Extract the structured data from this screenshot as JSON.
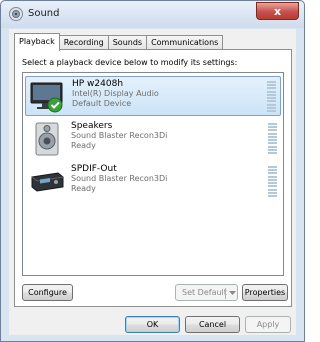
{
  "window": {
    "title": "Sound",
    "close_glyph": "x"
  },
  "tabs": [
    {
      "label": "Playback"
    },
    {
      "label": "Recording"
    },
    {
      "label": "Sounds"
    },
    {
      "label": "Communications"
    }
  ],
  "active_tab": "Playback",
  "instruction": "Select a playback device below to modify its settings:",
  "devices": [
    {
      "name": "HP w2408h",
      "description": "Intel(R) Display Audio",
      "status": "Default Device",
      "icon": "monitor-icon",
      "selected": true,
      "default": true
    },
    {
      "name": "Speakers",
      "description": "Sound Blaster Recon3Di",
      "status": "Ready",
      "icon": "speaker-icon",
      "selected": false,
      "default": false
    },
    {
      "name": "SPDIF-Out",
      "description": "Sound Blaster Recon3Di",
      "status": "Ready",
      "icon": "spdif-receiver-icon",
      "selected": false,
      "default": false
    }
  ],
  "buttons": {
    "configure": "Configure",
    "set_default": "Set Default",
    "properties": "Properties",
    "ok": "OK",
    "cancel": "Cancel",
    "apply": "Apply"
  },
  "colors": {
    "selection": "#cce4f7",
    "level_meter": "#b3c9d8",
    "check": "#3aa23a"
  }
}
